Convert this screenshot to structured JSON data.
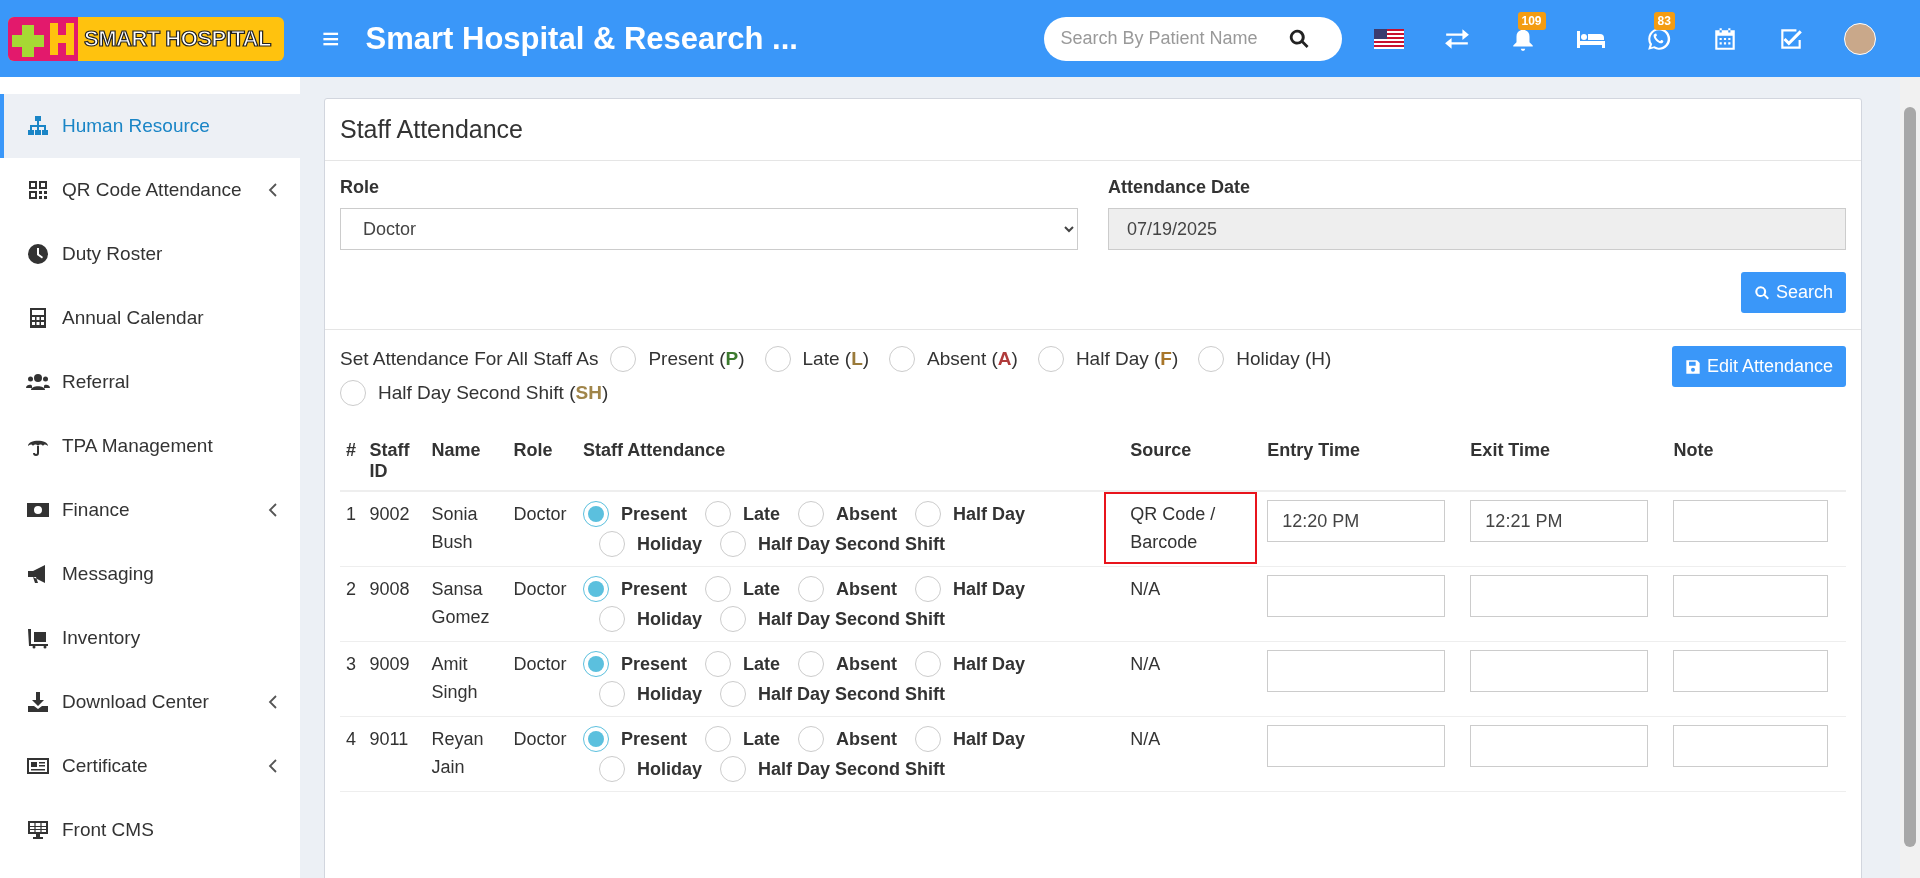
{
  "header": {
    "logo": "SMART HOSPITAL",
    "menu_icon": "≡",
    "title": "Smart Hospital & Research ...",
    "search": {
      "placeholder": "Search By Patient Name"
    },
    "badges": {
      "notifications": "109",
      "whatsapp": "83"
    }
  },
  "sidebar": {
    "items": [
      {
        "label": "Human Resource",
        "selected": true,
        "expandable": false
      },
      {
        "label": "QR Code Attendance",
        "selected": false,
        "expandable": true
      },
      {
        "label": "Duty Roster",
        "selected": false,
        "expandable": false
      },
      {
        "label": "Annual Calendar",
        "selected": false,
        "expandable": false
      },
      {
        "label": "Referral",
        "selected": false,
        "expandable": false
      },
      {
        "label": "TPA Management",
        "selected": false,
        "expandable": false
      },
      {
        "label": "Finance",
        "selected": false,
        "expandable": true
      },
      {
        "label": "Messaging",
        "selected": false,
        "expandable": false
      },
      {
        "label": "Inventory",
        "selected": false,
        "expandable": false
      },
      {
        "label": "Download Center",
        "selected": false,
        "expandable": true
      },
      {
        "label": "Certificate",
        "selected": false,
        "expandable": true
      },
      {
        "label": "Front CMS",
        "selected": false,
        "expandable": false
      }
    ]
  },
  "panel": {
    "title": "Staff Attendance",
    "role": {
      "label": "Role",
      "value": "Doctor"
    },
    "date": {
      "label": "Attendance Date",
      "value": "07/19/2025"
    },
    "search_button": "Search",
    "set_all": {
      "label": "Set Attendance For All Staff As",
      "options": [
        {
          "label": "Present (**P**)",
          "color": "#3c7a2e",
          "selected": false
        },
        {
          "label": "Late (**L**)",
          "color": "#9a7a3a",
          "selected": false
        },
        {
          "label": "Absent (**A**)",
          "color": "#b03a3a",
          "selected": false
        },
        {
          "label": "Half Day (**F**)",
          "color": "#a8762a",
          "selected": false
        },
        {
          "label": "Holiday (H)",
          "color": "#333333",
          "selected": false
        },
        {
          "label": "Half Day Second Shift (**SH**)",
          "color": "#a0854a",
          "selected": false
        }
      ]
    },
    "edit_button": "Edit Attendance",
    "table": {
      "columns": [
        "#",
        "Staff ID",
        "Name",
        "Role",
        "Staff Attendance",
        "Source",
        "Entry Time",
        "Exit Time",
        "Note"
      ],
      "rows": [
        {
          "num": "1",
          "staff_id": "9002",
          "name": "Sonia Bush",
          "role": "Doctor",
          "options": [
            {
              "label": "Present",
              "selected": true
            },
            {
              "label": "Late",
              "selected": false
            },
            {
              "label": "Absent",
              "selected": false
            },
            {
              "label": "Half Day",
              "selected": false
            },
            {
              "label": "Holiday",
              "selected": false
            },
            {
              "label": "Half Day Second Shift",
              "selected": false
            }
          ],
          "source": "QR Code / Barcode",
          "source_highlighted": true,
          "entry_time": "12:20 PM",
          "exit_time": "12:21 PM"
        },
        {
          "num": "2",
          "staff_id": "9008",
          "name": "Sansa Gomez",
          "role": "Doctor",
          "options": [
            {
              "label": "Present",
              "selected": true
            },
            {
              "label": "Late",
              "selected": false
            },
            {
              "label": "Absent",
              "selected": false
            },
            {
              "label": "Half Day",
              "selected": false
            },
            {
              "label": "Holiday",
              "selected": false
            },
            {
              "label": "Half Day Second Shift",
              "selected": false
            }
          ],
          "source": "N/A",
          "source_highlighted": false
        },
        {
          "num": "3",
          "staff_id": "9009",
          "name": "Amit Singh",
          "role": "Doctor",
          "options": [
            {
              "label": "Present",
              "selected": true
            },
            {
              "label": "Late",
              "selected": false
            },
            {
              "label": "Absent",
              "selected": false
            },
            {
              "label": "Half Day",
              "selected": false
            },
            {
              "label": "Holiday",
              "selected": false
            },
            {
              "label": "Half Day Second Shift",
              "selected": false
            }
          ],
          "source": "N/A",
          "source_highlighted": false
        },
        {
          "num": "4",
          "staff_id": "9011",
          "name": "Reyan Jain",
          "role": "Doctor",
          "options": [
            {
              "label": "Present",
              "selected": true
            },
            {
              "label": "Late",
              "selected": false
            },
            {
              "label": "Absent",
              "selected": false
            },
            {
              "label": "Half Day",
              "selected": false
            },
            {
              "label": "Holiday",
              "selected": false
            },
            {
              "label": "Half Day Second Shift",
              "selected": false
            }
          ],
          "source": "N/A",
          "source_highlighted": false
        }
      ]
    }
  }
}
